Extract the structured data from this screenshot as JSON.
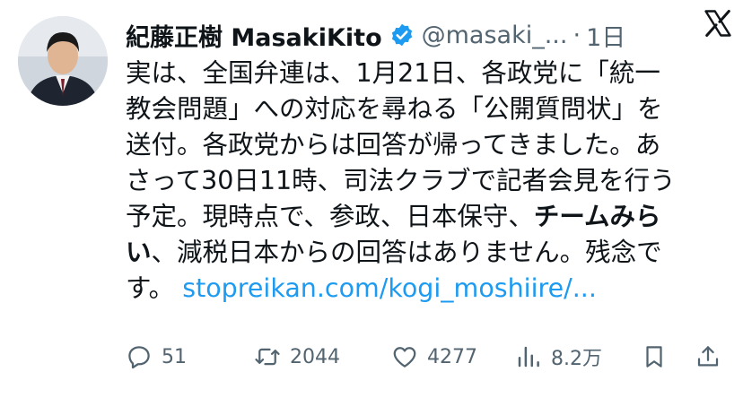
{
  "tweet": {
    "author_name": "紀藤正樹 MasakiKito",
    "handle": "@masaki_...",
    "separator": "·",
    "time": "1日",
    "body": {
      "line1": "実は、全国弁連は、1月21日、各政党に「統一",
      "line2": "教会問題」への対応を尋ねる「公開質問状」を",
      "line3": "送付。各政党からは回答が帰ってきました。あ",
      "line4": "さって30日11時、司法クラブで記者会見を行う",
      "line5_plain": "予定。現時点で、参政、日本保守、",
      "line5_bold": "チームみら",
      "line6_bold": "い",
      "line6_plain": "、減税日本からの回答はありません。残念で",
      "line7_plain": "す。",
      "link": "stopreikan.com/kogi_moshiire/..."
    },
    "actions": {
      "replies": "51",
      "retweets": "2044",
      "likes": "4277",
      "views": "8.2万"
    }
  },
  "icons": {
    "verified": "verified-badge-icon",
    "platform": "x-logo-icon",
    "reply": "reply-icon",
    "retweet": "retweet-icon",
    "like": "heart-icon",
    "views": "views-chart-icon",
    "bookmark": "bookmark-icon",
    "share": "share-icon"
  },
  "colors": {
    "text": "#0f1419",
    "secondary": "#536471",
    "link": "#1d9bf0",
    "verified": "#1d9bf0"
  }
}
